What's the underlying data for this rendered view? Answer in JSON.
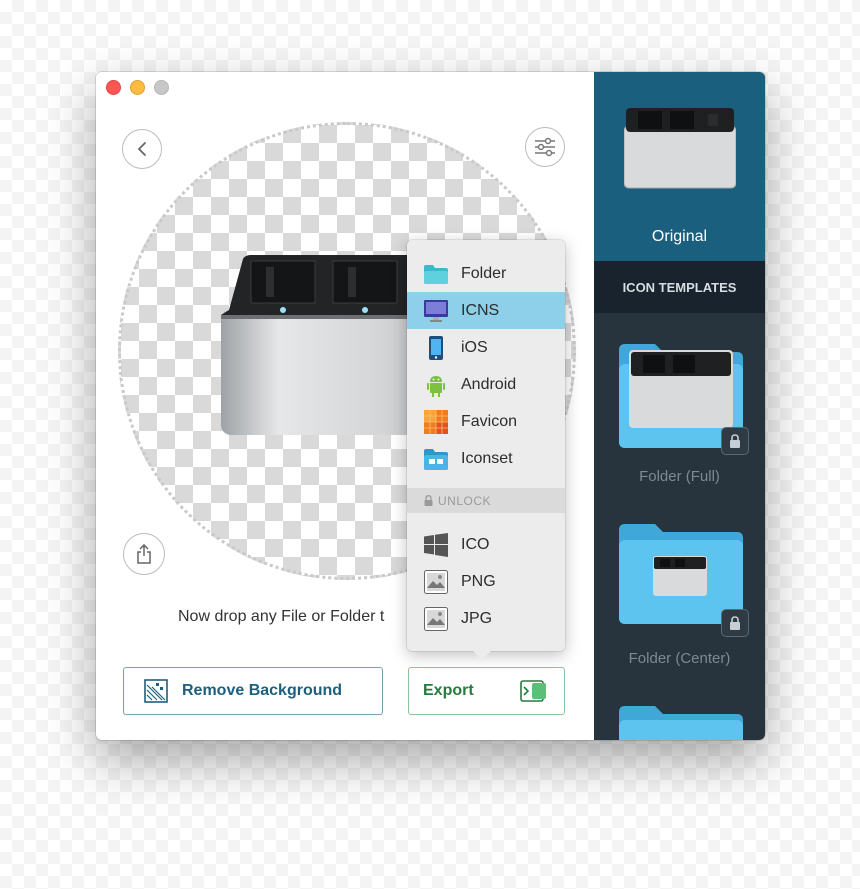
{
  "window": {
    "controls": [
      "close",
      "minimize",
      "maximize"
    ]
  },
  "toolbar": {
    "back_icon": "chevron-left-icon",
    "settings_icon": "sliders-icon",
    "share_icon": "share-icon"
  },
  "main": {
    "drop_text": "Now drop any File or Folder t",
    "remove_bg_label": "Remove Background",
    "export_label": "Export"
  },
  "export_menu": {
    "items": [
      {
        "label": "Folder",
        "icon": "folder-icon"
      },
      {
        "label": "ICNS",
        "icon": "monitor-icon",
        "selected": true
      },
      {
        "label": "iOS",
        "icon": "phone-icon"
      },
      {
        "label": "Android",
        "icon": "android-icon"
      },
      {
        "label": "Favicon",
        "icon": "favicon-icon"
      },
      {
        "label": "Iconset",
        "icon": "iconset-icon"
      }
    ],
    "unlock_label": "UNLOCK",
    "locked_items": [
      {
        "label": "ICO",
        "icon": "windows-icon"
      },
      {
        "label": "PNG",
        "icon": "image-icon"
      },
      {
        "label": "JPG",
        "icon": "image-icon"
      }
    ]
  },
  "sidebar": {
    "original_label": "Original",
    "templates_header": "ICON TEMPLATES",
    "templates": [
      {
        "label": "Folder (Full)",
        "locked": true
      },
      {
        "label": "Folder (Center)",
        "locked": true
      }
    ]
  },
  "colors": {
    "accent_blue": "#1b5f7f",
    "sidebar_bg": "#27333d",
    "selected_item": "#8ed0ea",
    "export_green": "#277a3e",
    "folder_blue": "#4ab8ea"
  }
}
